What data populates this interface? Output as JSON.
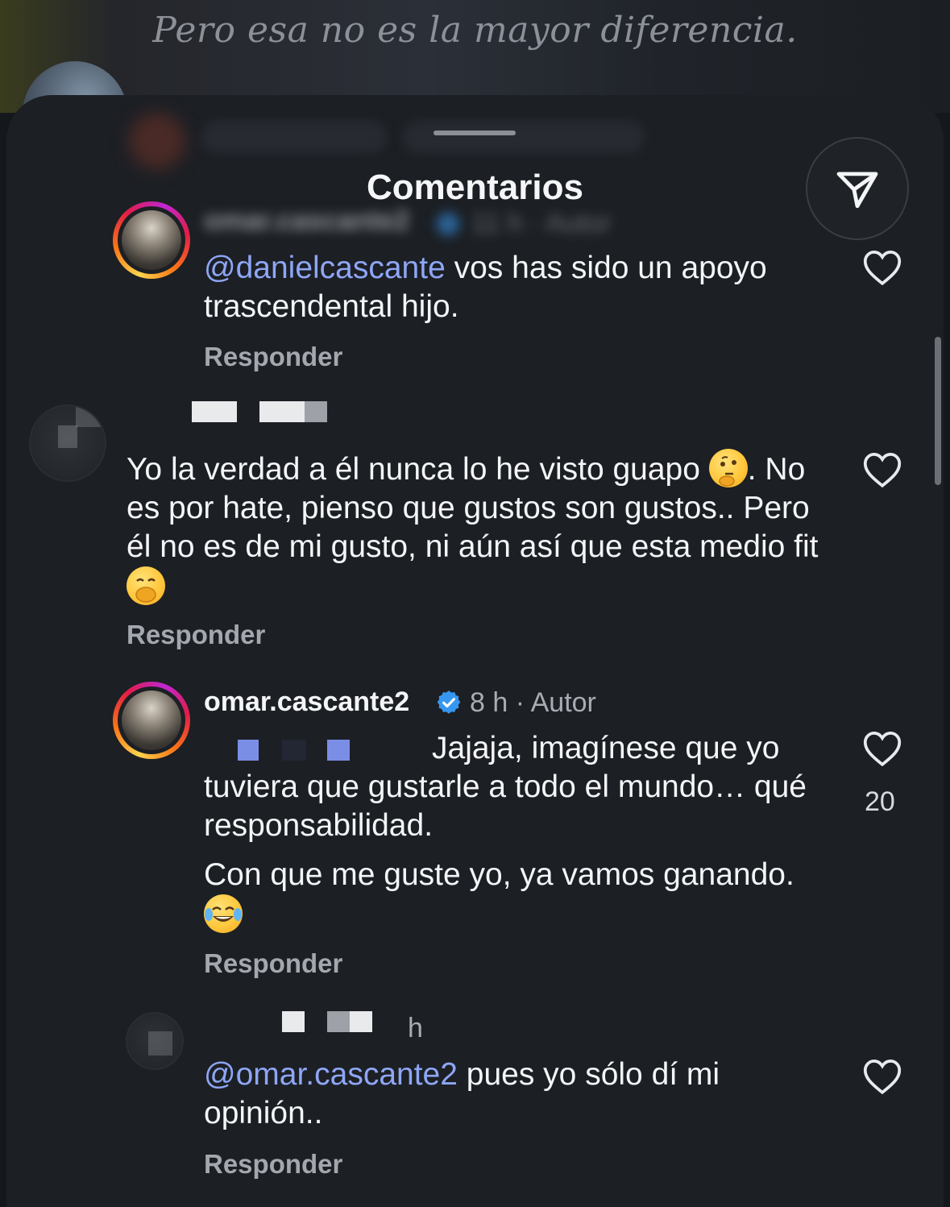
{
  "background": {
    "caption": "Pero esa no es la mayor diferencia."
  },
  "sheet": {
    "title": "Comentarios",
    "share_icon": "send-icon"
  },
  "comments": [
    {
      "username": "omar.cascante2",
      "time": "11 h",
      "author_tag": "Autor",
      "mention": "@danielcascante",
      "text": " vos has sido un apoyo trascendental hijo.",
      "reply_label": "Responder",
      "verified": true
    },
    {
      "text": "Yo la verdad a él nunca lo he visto guapo",
      "text_after_emoji1": ". No es por hate, pienso que gustos son gustos.. Pero él no es de mi gusto, ni aún así que esta medio fit",
      "emoji1": "thinking-face-emoji",
      "emoji2": "hand-over-mouth-emoji",
      "reply_label": "Responder"
    },
    {
      "username": "omar.cascante2",
      "time": "8 h",
      "author_tag": "· Autor",
      "text1": "Jajaja, imagínese que yo tuviera que gustarle a todo el mundo… qué responsabilidad.",
      "text2": "Con que me guste yo, ya vamos ganando.",
      "emoji": "tears-of-joy-emoji",
      "likes": "20",
      "reply_label": "Responder",
      "verified": true
    },
    {
      "time": "h",
      "mention": "@omar.cascante2",
      "text": " pues yo sólo dí mi opinión..",
      "reply_label": "Responder"
    }
  ],
  "colors": {
    "mention": "#8ea6f5",
    "verified": "#3797f0",
    "sheet_bg": "#1c1f24"
  }
}
